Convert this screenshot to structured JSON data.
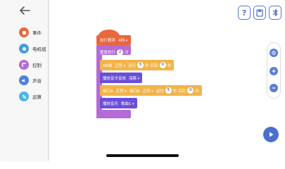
{
  "sidebar": {
    "categories": [
      {
        "label": "事件",
        "color": "#e9673c"
      },
      {
        "label": "电机组",
        "color": "#4a9be0"
      },
      {
        "label": "控制",
        "color": "#b56ad6"
      },
      {
        "label": "声音",
        "color": "#4f80e0"
      },
      {
        "label": "运算",
        "color": "#4ab7e6"
      }
    ]
  },
  "blocks": {
    "hat": {
      "label": "执行程序",
      "value": "4档"
    },
    "repeat": {
      "label": "重复执行",
      "count": "2",
      "suffix": "次"
    },
    "motor_ab": {
      "port": "AB端",
      "dir": "正转",
      "run": "运行",
      "time": "5",
      "sec": "秒",
      "then": "后后",
      "power": "0",
      "unit": "秒"
    },
    "play_cmd": {
      "label": "播放音令音效",
      "value": "海豚"
    },
    "motor_a": {
      "port": "端口A",
      "dir1": "正转",
      "port2": "端口B",
      "dir2": "正转",
      "run": "运行",
      "time": "5",
      "sec": "秒",
      "then": "后后",
      "power": "0",
      "unit": "秒"
    },
    "play_music": {
      "label": "播放音乐",
      "value": "歌曲1"
    }
  },
  "topbar": {
    "help": "?"
  },
  "colors": {
    "accent": "#4a6fd0",
    "event": "#e9673c",
    "control": "#b56ad6",
    "motor": "#f2b44a",
    "sound": "#6b4fd6"
  }
}
